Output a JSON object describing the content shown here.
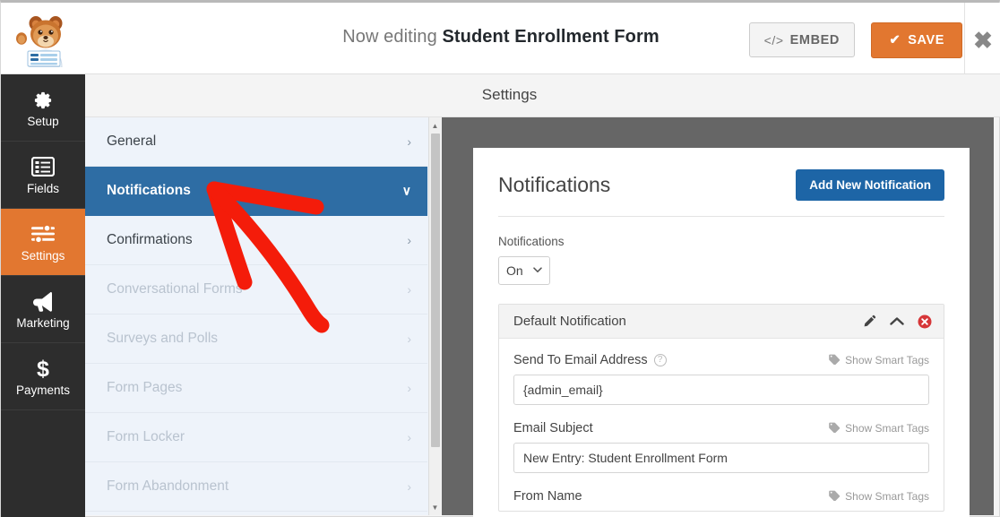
{
  "topbar": {
    "logo_name": "wpforms-bear-logo",
    "editing_prefix": "Now editing ",
    "form_name": "Student Enrollment Form",
    "embed_label": "EMBED",
    "embed_icon_text": "</>",
    "save_label": "SAVE",
    "save_check": "✔",
    "close_label": "✖"
  },
  "sidebar": {
    "items": [
      {
        "label": "Setup",
        "icon": "gear-icon",
        "active": false
      },
      {
        "label": "Fields",
        "icon": "list-icon",
        "active": false
      },
      {
        "label": "Settings",
        "icon": "sliders-icon",
        "active": true
      },
      {
        "label": "Marketing",
        "icon": "megaphone-icon",
        "active": false
      },
      {
        "label": "Payments",
        "icon": "dollar-icon",
        "active": false
      }
    ]
  },
  "settings_panel": {
    "title": "Settings",
    "items": [
      {
        "label": "General",
        "state": "normal",
        "chevron": "›"
      },
      {
        "label": "Notifications",
        "state": "active",
        "chevron": "∨"
      },
      {
        "label": "Confirmations",
        "state": "normal",
        "chevron": "›"
      },
      {
        "label": "Conversational Forms",
        "state": "muted",
        "chevron": "›"
      },
      {
        "label": "Surveys and Polls",
        "state": "muted",
        "chevron": "›"
      },
      {
        "label": "Form Pages",
        "state": "muted",
        "chevron": "›"
      },
      {
        "label": "Form Locker",
        "state": "muted",
        "chevron": "›"
      },
      {
        "label": "Form Abandonment",
        "state": "muted",
        "chevron": "›"
      }
    ],
    "scrollbar": {
      "up_arrow": "▲",
      "down_arrow": "▼"
    }
  },
  "main": {
    "heading": "Notifications",
    "add_button": "Add New Notification",
    "toggle_label": "Notifications",
    "toggle_value": "On",
    "toggle_caret": "⌄",
    "notification": {
      "title": "Default Notification",
      "icons": {
        "edit": "pencil-icon",
        "collapse": "chevron-up-icon",
        "delete": "delete-circle-icon"
      },
      "fields": [
        {
          "label": "Send To Email Address",
          "has_help": true,
          "help_glyph": "?",
          "smart_tags": "Show Smart Tags",
          "value": "{admin_email}"
        },
        {
          "label": "Email Subject",
          "has_help": false,
          "smart_tags": "Show Smart Tags",
          "value": "New Entry: Student Enrollment Form"
        },
        {
          "label": "From Name",
          "has_help": false,
          "smart_tags": "Show Smart Tags",
          "value": ""
        }
      ]
    }
  },
  "colors": {
    "accent_orange": "#e27730",
    "accent_blue": "#2e6da4",
    "button_blue": "#1d65a6",
    "sidebar_dark": "#2d2d2d",
    "backdrop_gray": "#666666",
    "annotation_red": "#f41c0a",
    "list_bg": "#eef3fa"
  }
}
